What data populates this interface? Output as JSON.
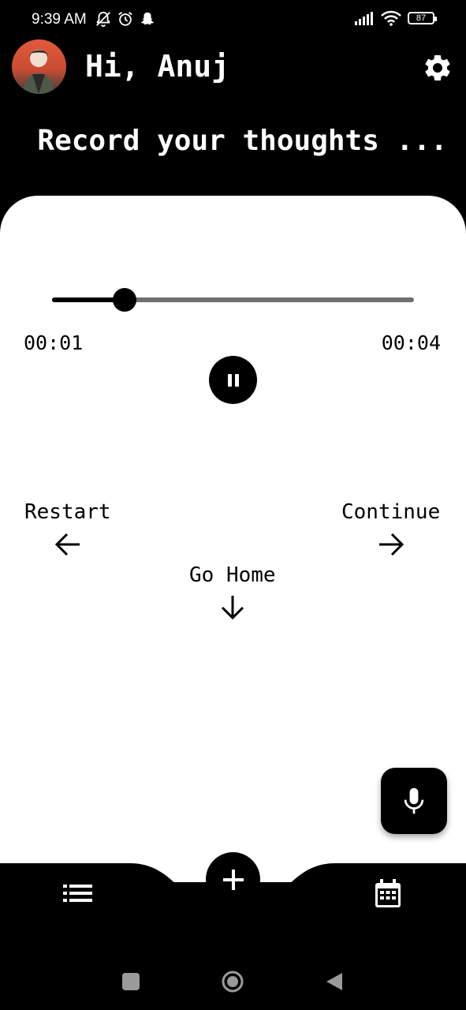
{
  "status_bar": {
    "time": "9:39 AM",
    "battery": "87",
    "icons": [
      "notifications-off-icon",
      "alarm-icon",
      "snapchat-icon",
      "signal-icon",
      "wifi-icon",
      "battery-icon"
    ]
  },
  "header": {
    "greeting": "Hi, Anuj",
    "tagline": "Record your thoughts ..."
  },
  "player": {
    "current_time": "00:01",
    "total_time": "00:04",
    "progress": 0.2,
    "state": "playing"
  },
  "actions": {
    "restart_label": "Restart",
    "continue_label": "Continue",
    "go_home_label": "Go Home"
  },
  "bottom_nav": {
    "left_icon": "list-icon",
    "center_icon": "add-icon",
    "right_icon": "calendar-icon"
  },
  "colors": {
    "background": "#000000",
    "card": "#ffffff",
    "track": "#6f6f6f",
    "accent": "#000000"
  }
}
